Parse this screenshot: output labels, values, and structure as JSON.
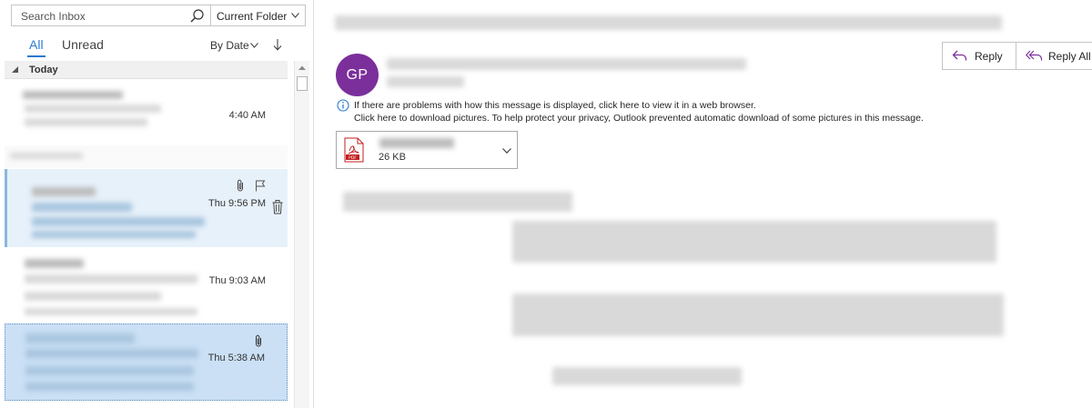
{
  "search": {
    "placeholder": "Search Inbox",
    "scope": "Current Folder"
  },
  "filters": {
    "all": "All",
    "unread": "Unread",
    "sort_label": "By Date"
  },
  "group": {
    "label": "Today"
  },
  "messages": [
    {
      "time": "4:40 AM",
      "has_attachment": false,
      "flag_visible": false,
      "selected": false
    },
    {
      "time": "Thu 9:56 PM",
      "has_attachment": true,
      "flag_visible": true,
      "selected": false,
      "hovered": true
    },
    {
      "time": "Thu 9:03 AM",
      "has_attachment": false,
      "flag_visible": false,
      "selected": false
    },
    {
      "time": "Thu 5:38 AM",
      "has_attachment": true,
      "flag_visible": false,
      "selected": true
    }
  ],
  "reading_pane": {
    "sender_initials": "GP",
    "avatar_color": "#7b2f9b",
    "reply_label": "Reply",
    "reply_all_label": "Reply All",
    "info_line_1": "If there are problems with how this message is displayed, click here to view it in a web browser.",
    "info_line_2": "Click here to download pictures. To help protect your privacy, Outlook prevented automatic download of some pictures in this message.",
    "attachment": {
      "type": "PDF",
      "size": "26 KB"
    }
  },
  "colors": {
    "accent": "#2b79d0",
    "selected_row": "#cbe0f5",
    "hover_row": "#e7f1fa",
    "reply_icon": "#7b2f9b"
  }
}
